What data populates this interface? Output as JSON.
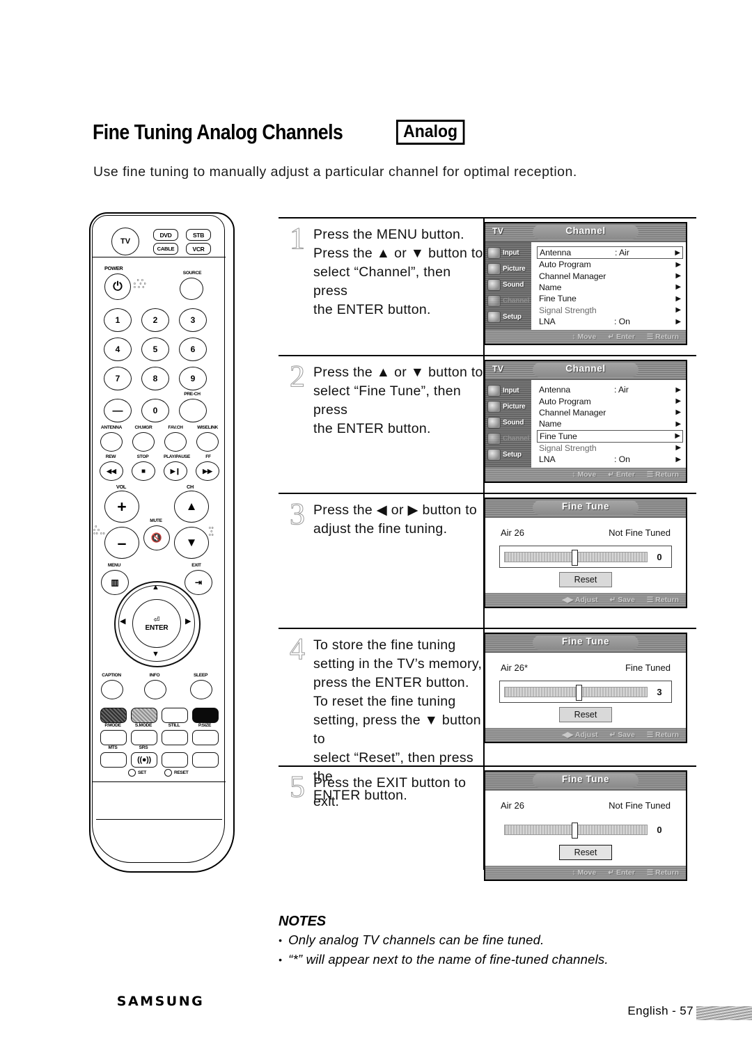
{
  "document": {
    "title": "Fine Tuning Analog Channels",
    "badge": "Analog",
    "intro": "Use fine tuning to manually adjust a particular channel for optimal reception.",
    "footer": "English - 57"
  },
  "notes": {
    "heading": "NOTES",
    "bullet": "•",
    "items": [
      "Only analog TV channels can be fine tuned.",
      "“*” will appear next to the name of fine-tuned channels."
    ]
  },
  "steps": [
    {
      "number": "1",
      "lines": [
        "Press the MENU button.",
        "Press the ▲ or ▼ button to",
        "select “Channel”, then press",
        "the ENTER button."
      ]
    },
    {
      "number": "2",
      "lines": [
        "Press the ▲ or ▼ button to",
        "select “Fine Tune”, then press",
        "the ENTER button."
      ]
    },
    {
      "number": "3",
      "lines": [
        "Press the ◀ or ▶ button to",
        "adjust the fine tuning."
      ]
    },
    {
      "number": "4",
      "lines": [
        "To store the fine tuning",
        "setting in the TV’s memory,",
        "press the ENTER button.",
        "To reset the fine tuning",
        "setting, press the ▼ button to",
        "select “Reset”, then press the",
        "ENTER button."
      ]
    },
    {
      "number": "5",
      "lines": [
        "Press the EXIT button to exit."
      ]
    }
  ],
  "osd": {
    "channel_menu": {
      "tv_label": "TV",
      "title": "Channel",
      "sidebar": [
        {
          "label": "Input",
          "state": "normal"
        },
        {
          "label": "Picture",
          "state": "normal"
        },
        {
          "label": "Sound",
          "state": "normal"
        },
        {
          "label": "Channel",
          "state": "active"
        },
        {
          "label": "Setup",
          "state": "normal"
        }
      ],
      "rows": [
        {
          "name": "Antenna",
          "value": ": Air",
          "arrow": "▶"
        },
        {
          "name": "Auto Program",
          "value": "",
          "arrow": "▶"
        },
        {
          "name": "Channel Manager",
          "value": "",
          "arrow": "▶"
        },
        {
          "name": "Name",
          "value": "",
          "arrow": "▶"
        },
        {
          "name": "Fine Tune",
          "value": "",
          "arrow": "▶"
        },
        {
          "name": "Signal Strength",
          "value": "",
          "arrow": "▶"
        },
        {
          "name": "LNA",
          "value": ": On",
          "arrow": "▶"
        }
      ],
      "selected_step1": "Antenna",
      "selected_step2": "Fine Tune",
      "footer": [
        {
          "icon": "↕",
          "label": "Move"
        },
        {
          "icon": "↵",
          "label": "Enter"
        },
        {
          "icon": "☰",
          "label": "Return"
        }
      ]
    },
    "fine_tune_step3": {
      "title": "Fine Tune",
      "channel": "Air 26",
      "state": "Not Fine Tuned",
      "value": "0",
      "knob_percent": 50,
      "reset_label": "Reset",
      "reset_highlighted": false,
      "bar_boxed": true,
      "footer": [
        {
          "icon": "◀▶",
          "label": "Adjust"
        },
        {
          "icon": "↵",
          "label": "Save"
        },
        {
          "icon": "☰",
          "label": "Return"
        }
      ]
    },
    "fine_tune_step4": {
      "title": "Fine Tune",
      "channel": "Air 26*",
      "state": "Fine Tuned",
      "value": "3",
      "knob_percent": 53,
      "reset_label": "Reset",
      "reset_highlighted": false,
      "bar_boxed": true,
      "footer": [
        {
          "icon": "◀▶",
          "label": "Adjust"
        },
        {
          "icon": "↵",
          "label": "Save"
        },
        {
          "icon": "☰",
          "label": "Return"
        }
      ]
    },
    "fine_tune_step5": {
      "title": "Fine Tune",
      "channel": "Air 26",
      "state": "Not Fine Tuned",
      "value": "0",
      "knob_percent": 50,
      "reset_label": "Reset",
      "reset_highlighted": true,
      "bar_boxed": false,
      "footer": [
        {
          "icon": "↕",
          "label": "Move"
        },
        {
          "icon": "↵",
          "label": "Enter"
        },
        {
          "icon": "☰",
          "label": "Return"
        }
      ]
    }
  },
  "remote": {
    "brand": "SAMSUNG",
    "mode_buttons": [
      {
        "label": "TV",
        "shape": "circle"
      },
      {
        "label": "DVD",
        "shape": "rect"
      },
      {
        "label": "STB",
        "shape": "rect"
      },
      {
        "label": "CABLE",
        "shape": "rect"
      },
      {
        "label": "VCR",
        "shape": "rect"
      }
    ],
    "power_label": "POWER",
    "power_glyph": "⏻",
    "source_label": "SOURCE",
    "numbers": [
      "1",
      "2",
      "3",
      "4",
      "5",
      "6",
      "7",
      "8",
      "9",
      "—",
      "0"
    ],
    "pre_ch_label": "PRE-CH",
    "function_row": [
      "ANTENNA",
      "CH.MGR",
      "FAV.CH",
      "WISELINK"
    ],
    "transport_row": [
      {
        "label": "REW",
        "glyph": "◀◀"
      },
      {
        "label": "STOP",
        "glyph": "■"
      },
      {
        "label": "PLAY/PAUSE",
        "glyph": "▶❙"
      },
      {
        "label": "FF",
        "glyph": "▶▶"
      }
    ],
    "vol_label": "VOL",
    "ch_label": "CH",
    "mute_label": "MUTE",
    "mute_glyph": "🔇",
    "menu_label": "MENU",
    "exit_label": "EXIT",
    "enter_label": "ENTER",
    "nav_arrows": {
      "up": "▲",
      "down": "▼",
      "left": "◀",
      "right": "▶"
    },
    "bottom_row1": [
      "CAPTION",
      "INFO",
      "SLEEP"
    ],
    "mode_pad": [
      "P.MODE",
      "S.MODE",
      "STILL",
      "P.SIZE"
    ],
    "audio_pad": [
      "MTS",
      "SRS"
    ],
    "set_label": "SET",
    "reset_label": "RESET"
  }
}
